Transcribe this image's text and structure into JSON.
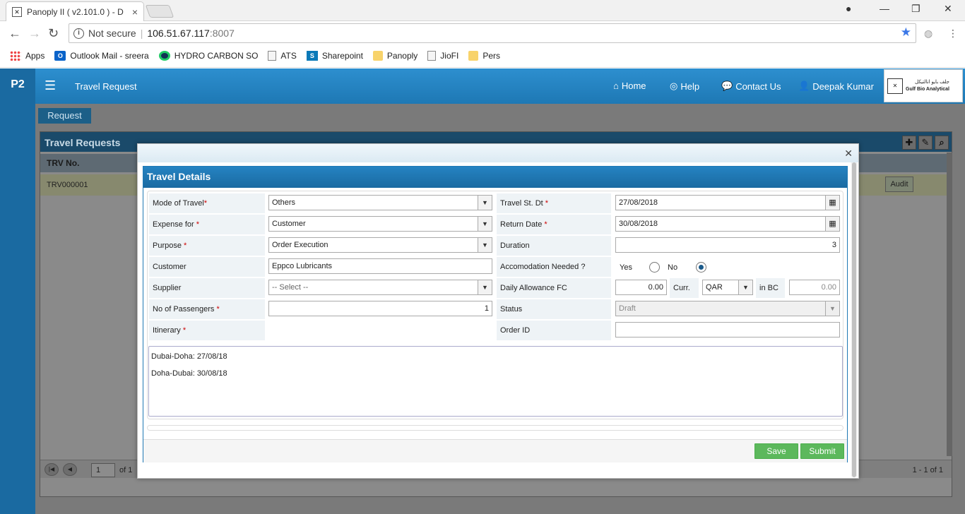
{
  "browser": {
    "tab_title": "Panoply II ( v2.101.0 ) - D",
    "security": "Not secure",
    "url_host": "106.51.67.117",
    "url_port": ":8007",
    "bookmarks": [
      {
        "label": "Apps",
        "icon": "apps-icon"
      },
      {
        "label": "Outlook Mail - sreera",
        "icon": "outlook-icon"
      },
      {
        "label": "HYDRO CARBON SO",
        "icon": "hydro-icon"
      },
      {
        "label": "ATS",
        "icon": "file-icon"
      },
      {
        "label": "Sharepoint",
        "icon": "sharepoint-icon"
      },
      {
        "label": "Panoply",
        "icon": "folder-icon"
      },
      {
        "label": "JioFI",
        "icon": "file-icon"
      },
      {
        "label": "Pers",
        "icon": "folder-icon"
      }
    ]
  },
  "header": {
    "brand": "P2",
    "title": "Travel Request",
    "nav": {
      "home": "Home",
      "help": "Help",
      "contact": "Contact Us",
      "user": "Deepak Kumar"
    },
    "logo_arabic": "جلف بايو انالتيكل",
    "logo_text": "Gulf Bio Analytical"
  },
  "page": {
    "tab": "Request",
    "grid_title": "Travel Requests",
    "col_trv": "TRV No.",
    "row_trv": "TRV000001",
    "audit": "Audit",
    "page_num": "1",
    "page_of": "of 1",
    "page_count": "1 - 1 of 1"
  },
  "modal": {
    "title": "Travel Details",
    "labels": {
      "mode": "Mode of Travel",
      "expense": "Expense for",
      "purpose": "Purpose",
      "customer": "Customer",
      "supplier": "Supplier",
      "passengers": "No of Passengers",
      "itinerary": "Itinerary",
      "start": "Travel St. Dt",
      "return": "Return Date",
      "duration": "Duration",
      "accom": "Accomodation Needed ?",
      "allowance": "Daily Allowance FC",
      "curr": "Curr.",
      "inbc": "in BC",
      "status": "Status",
      "order": "Order ID"
    },
    "values": {
      "mode": "Others",
      "expense": "Customer",
      "purpose": "Order Execution",
      "customer": "Eppco Lubricants",
      "supplier": "-- Select --",
      "passengers": "1",
      "start": "27/08/2018",
      "return": "30/08/2018",
      "duration": "3",
      "accom_yes": "Yes",
      "accom_no": "No",
      "allowance": "0.00",
      "curr": "QAR",
      "inbc": "0.00",
      "status": "Draft",
      "order": ""
    },
    "itinerary": "Dubai-Doha: 27/08/18\nDoha-Dubai: 30/08/18",
    "buttons": {
      "save": "Save",
      "submit": "Submit"
    }
  },
  "colors": {
    "header_blue": "#1e78b4",
    "save_green": "#5cb85c"
  }
}
